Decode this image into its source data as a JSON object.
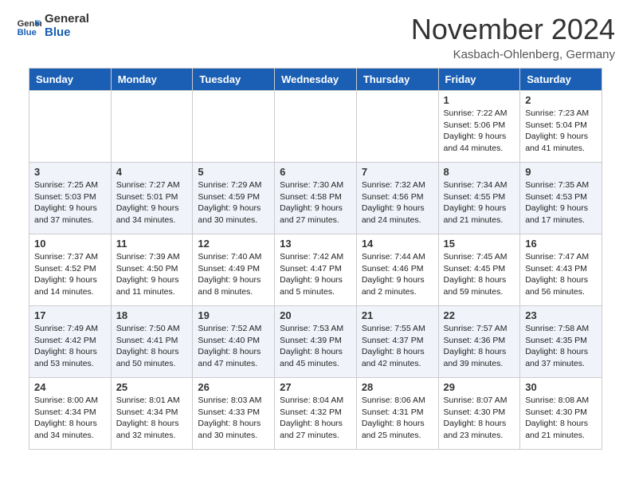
{
  "header": {
    "logo_line1": "General",
    "logo_line2": "Blue",
    "month_title": "November 2024",
    "location": "Kasbach-Ohlenberg, Germany"
  },
  "calendar": {
    "days_of_week": [
      "Sunday",
      "Monday",
      "Tuesday",
      "Wednesday",
      "Thursday",
      "Friday",
      "Saturday"
    ],
    "weeks": [
      [
        {
          "day": "",
          "info": ""
        },
        {
          "day": "",
          "info": ""
        },
        {
          "day": "",
          "info": ""
        },
        {
          "day": "",
          "info": ""
        },
        {
          "day": "",
          "info": ""
        },
        {
          "day": "1",
          "info": "Sunrise: 7:22 AM\nSunset: 5:06 PM\nDaylight: 9 hours and 44 minutes."
        },
        {
          "day": "2",
          "info": "Sunrise: 7:23 AM\nSunset: 5:04 PM\nDaylight: 9 hours and 41 minutes."
        }
      ],
      [
        {
          "day": "3",
          "info": "Sunrise: 7:25 AM\nSunset: 5:03 PM\nDaylight: 9 hours and 37 minutes."
        },
        {
          "day": "4",
          "info": "Sunrise: 7:27 AM\nSunset: 5:01 PM\nDaylight: 9 hours and 34 minutes."
        },
        {
          "day": "5",
          "info": "Sunrise: 7:29 AM\nSunset: 4:59 PM\nDaylight: 9 hours and 30 minutes."
        },
        {
          "day": "6",
          "info": "Sunrise: 7:30 AM\nSunset: 4:58 PM\nDaylight: 9 hours and 27 minutes."
        },
        {
          "day": "7",
          "info": "Sunrise: 7:32 AM\nSunset: 4:56 PM\nDaylight: 9 hours and 24 minutes."
        },
        {
          "day": "8",
          "info": "Sunrise: 7:34 AM\nSunset: 4:55 PM\nDaylight: 9 hours and 21 minutes."
        },
        {
          "day": "9",
          "info": "Sunrise: 7:35 AM\nSunset: 4:53 PM\nDaylight: 9 hours and 17 minutes."
        }
      ],
      [
        {
          "day": "10",
          "info": "Sunrise: 7:37 AM\nSunset: 4:52 PM\nDaylight: 9 hours and 14 minutes."
        },
        {
          "day": "11",
          "info": "Sunrise: 7:39 AM\nSunset: 4:50 PM\nDaylight: 9 hours and 11 minutes."
        },
        {
          "day": "12",
          "info": "Sunrise: 7:40 AM\nSunset: 4:49 PM\nDaylight: 9 hours and 8 minutes."
        },
        {
          "day": "13",
          "info": "Sunrise: 7:42 AM\nSunset: 4:47 PM\nDaylight: 9 hours and 5 minutes."
        },
        {
          "day": "14",
          "info": "Sunrise: 7:44 AM\nSunset: 4:46 PM\nDaylight: 9 hours and 2 minutes."
        },
        {
          "day": "15",
          "info": "Sunrise: 7:45 AM\nSunset: 4:45 PM\nDaylight: 8 hours and 59 minutes."
        },
        {
          "day": "16",
          "info": "Sunrise: 7:47 AM\nSunset: 4:43 PM\nDaylight: 8 hours and 56 minutes."
        }
      ],
      [
        {
          "day": "17",
          "info": "Sunrise: 7:49 AM\nSunset: 4:42 PM\nDaylight: 8 hours and 53 minutes."
        },
        {
          "day": "18",
          "info": "Sunrise: 7:50 AM\nSunset: 4:41 PM\nDaylight: 8 hours and 50 minutes."
        },
        {
          "day": "19",
          "info": "Sunrise: 7:52 AM\nSunset: 4:40 PM\nDaylight: 8 hours and 47 minutes."
        },
        {
          "day": "20",
          "info": "Sunrise: 7:53 AM\nSunset: 4:39 PM\nDaylight: 8 hours and 45 minutes."
        },
        {
          "day": "21",
          "info": "Sunrise: 7:55 AM\nSunset: 4:37 PM\nDaylight: 8 hours and 42 minutes."
        },
        {
          "day": "22",
          "info": "Sunrise: 7:57 AM\nSunset: 4:36 PM\nDaylight: 8 hours and 39 minutes."
        },
        {
          "day": "23",
          "info": "Sunrise: 7:58 AM\nSunset: 4:35 PM\nDaylight: 8 hours and 37 minutes."
        }
      ],
      [
        {
          "day": "24",
          "info": "Sunrise: 8:00 AM\nSunset: 4:34 PM\nDaylight: 8 hours and 34 minutes."
        },
        {
          "day": "25",
          "info": "Sunrise: 8:01 AM\nSunset: 4:34 PM\nDaylight: 8 hours and 32 minutes."
        },
        {
          "day": "26",
          "info": "Sunrise: 8:03 AM\nSunset: 4:33 PM\nDaylight: 8 hours and 30 minutes."
        },
        {
          "day": "27",
          "info": "Sunrise: 8:04 AM\nSunset: 4:32 PM\nDaylight: 8 hours and 27 minutes."
        },
        {
          "day": "28",
          "info": "Sunrise: 8:06 AM\nSunset: 4:31 PM\nDaylight: 8 hours and 25 minutes."
        },
        {
          "day": "29",
          "info": "Sunrise: 8:07 AM\nSunset: 4:30 PM\nDaylight: 8 hours and 23 minutes."
        },
        {
          "day": "30",
          "info": "Sunrise: 8:08 AM\nSunset: 4:30 PM\nDaylight: 8 hours and 21 minutes."
        }
      ]
    ]
  }
}
